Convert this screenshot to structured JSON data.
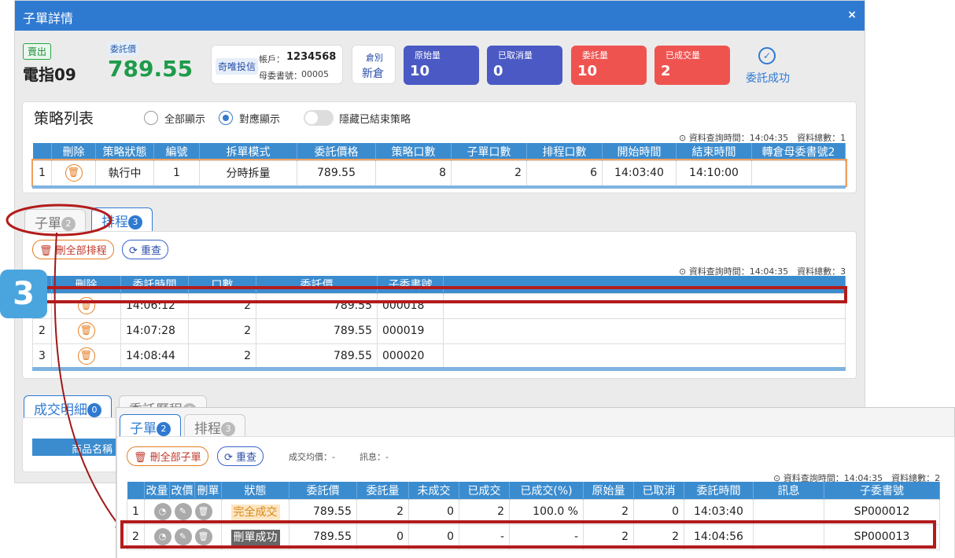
{
  "dialog": {
    "title": "子單詳情",
    "close": "×"
  },
  "header": {
    "side": "賣出",
    "product": "電指09",
    "price_label": "委託價",
    "price": "789.55",
    "broker": "奇唯投信",
    "account_label": "帳戶：",
    "account": "1234568",
    "parent_label": "母委書號：",
    "parent_no": "00005",
    "position_label": "倉別",
    "position": "新倉",
    "stats": [
      {
        "label": "原始量",
        "value": "10",
        "color": "#4a59c4"
      },
      {
        "label": "已取消量",
        "value": "0",
        "color": "#4a59c4"
      },
      {
        "label": "委託量",
        "value": "10",
        "color": "#ef5350"
      },
      {
        "label": "已成交量",
        "value": "2",
        "color": "#ef5350"
      }
    ],
    "status": "委託成功"
  },
  "strategy": {
    "title": "策略列表",
    "radio_all": "全部顯示",
    "radio_match": "對應顯示",
    "toggle_label": "隱藏已結束策略",
    "query_info": "資料查詢時間：14:04:35　資料總數：1",
    "columns": [
      "",
      "刪除",
      "策略狀態",
      "編號",
      "拆單模式",
      "委託價格",
      "策略口數",
      "子單口數",
      "排程口數",
      "開始時間",
      "結束時間",
      "轉倉母委書號2"
    ],
    "rows": [
      {
        "idx": "1",
        "status": "執行中",
        "no": "1",
        "mode": "分時拆量",
        "price": "789.55",
        "lots": "8",
        "child": "2",
        "sched": "6",
        "start": "14:03:40",
        "end": "14:10:00",
        "parent2": ""
      }
    ]
  },
  "tabs1": {
    "child": "子單",
    "child_count": "2",
    "sched": "排程",
    "sched_count": "3"
  },
  "schedule": {
    "delete_all": "刪全部排程",
    "reset": "重查",
    "query_info": "資料查詢時間：14:04:35　資料總數：3",
    "columns": [
      "",
      "刪除",
      "委託時間",
      "口數",
      "委託價",
      "子委書號"
    ],
    "rows": [
      {
        "idx": "1",
        "time": "14:06:12",
        "lots": "2",
        "price": "789.55",
        "no": "000018"
      },
      {
        "idx": "2",
        "time": "14:07:28",
        "lots": "2",
        "price": "789.55",
        "no": "000019"
      },
      {
        "idx": "3",
        "time": "14:08:44",
        "lots": "2",
        "price": "789.55",
        "no": "000020"
      }
    ]
  },
  "step_number": "3",
  "tabs2": {
    "deals": "成交明細",
    "deals_count": "0",
    "history": "委託歷程",
    "history_count": "0",
    "product_col": "商品名稱"
  },
  "overlay": {
    "tab_child": "子單",
    "tab_child_count": "2",
    "tab_sched": "排程",
    "tab_sched_count": "3",
    "delete_all": "刪全部子單",
    "reset": "重查",
    "avg_label": "成交均價：-",
    "msg_label": "訊息：-",
    "query_info": "資料查詢時間：14:04:35　資料總數：2",
    "columns": [
      "",
      "改量",
      "改價",
      "刪單",
      "狀態",
      "委託價",
      "委託量",
      "未成交",
      "已成交",
      "已成交(%)",
      "原始量",
      "已取消",
      "委託時間",
      "訊息",
      "子委書號"
    ],
    "rows": [
      {
        "idx": "1",
        "status": "完全成交",
        "price": "789.55",
        "qty": "2",
        "unfilled": "0",
        "filled": "2",
        "pct": "100.0 %",
        "orig": "2",
        "cancel": "0",
        "time": "14:03:40",
        "msg": "",
        "no": "SP000012"
      },
      {
        "idx": "2",
        "status": "刪單成功",
        "price": "789.55",
        "qty": "0",
        "unfilled": "0",
        "filled": "-",
        "pct": "-",
        "orig": "2",
        "cancel": "2",
        "time": "14:04:56",
        "msg": "",
        "no": "SP000013"
      }
    ]
  },
  "colors": {
    "header_blue": "#2f7ad1",
    "table_blue": "#3b8ccf",
    "annotation_red": "#b31b1b",
    "price_green": "#1e9b4a"
  }
}
